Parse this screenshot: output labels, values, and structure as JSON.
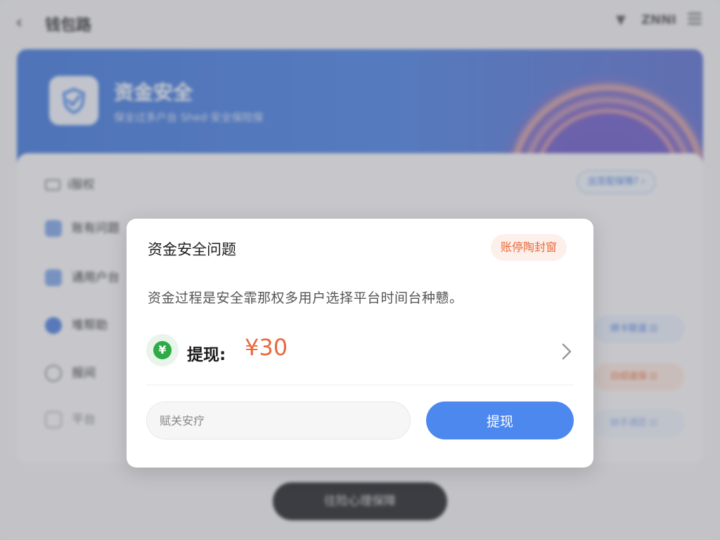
{
  "topbar": {
    "back_icon": "back-arrow-icon",
    "title": "钱包路",
    "time": "ZNNI",
    "signal_icon": "signal-icon",
    "more_icon": "more-icon"
  },
  "hero": {
    "title": "资金安全",
    "subtitle": "保全过多户台 Shed·安全保险保",
    "logo_icon": "shield-logo-icon"
  },
  "panel": {
    "header": "i服权",
    "pill": "出至配保情? ›",
    "rows": [
      {
        "label": "账有问题",
        "icon": "edit-icon",
        "icon_color": "#7ea6ea"
      },
      {
        "label": "通用户台",
        "icon": "card-icon",
        "icon_color": "#7ea6ea"
      },
      {
        "label": "堆帮助",
        "icon": "clock-icon",
        "icon_color": "#4d7fe0",
        "pill": "绑卡联道 ⊡",
        "pill_color": "#4a7fe0",
        "pill_bg": "#e6eefc"
      },
      {
        "label": "报间",
        "icon": "circle-icon",
        "icon_color": "#888888",
        "pill": "白绍道保 ⊡",
        "pill_color": "#e8693b",
        "pill_bg": "#fbe9e2"
      },
      {
        "label": "平台",
        "icon": "box-icon",
        "icon_color": "#888888",
        "pill": "缺手通匝 ⊡",
        "pill_color": "#4a7fe0",
        "pill_bg": "#e6eefc"
      }
    ]
  },
  "bottom_button": "往险心理保障",
  "dialog": {
    "title": "资金安全问题",
    "tag": "账停陶封窗",
    "description": "资金过程是安全霏那权多用户选择平台时间台种戆。",
    "amount_label": "提现:",
    "amount_value": "¥30",
    "coin_symbol": "¥",
    "input_placeholder": "赋关安疗",
    "submit_label": "提现",
    "colors": {
      "accent": "#e8693b",
      "primary": "#4d88ef",
      "coin": "#2eab45"
    }
  }
}
